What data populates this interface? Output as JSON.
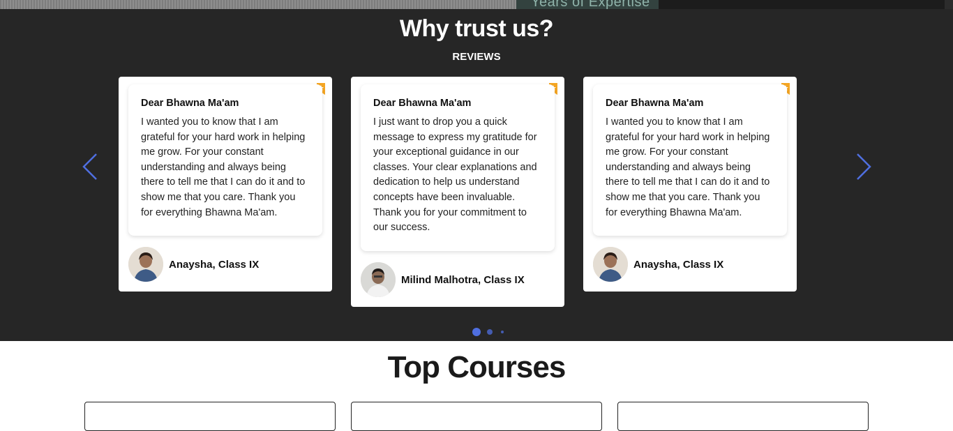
{
  "banner": {
    "expertise_text": "Years of Expertise"
  },
  "reviews_section": {
    "title": "Why trust us?",
    "subtitle": "REVIEWS",
    "prev_icon": "chevron-left-icon",
    "next_icon": "chevron-right-icon",
    "accent_color": "#4f6fe0",
    "bookmark_color": "#f5a623",
    "cards": [
      {
        "heading": "Dear Bhawna Ma'am",
        "body": "I wanted you to know that I am grateful for your hard work in helping me grow. For your constant understanding and always being there to tell me that I can do it and to show me that you care. Thank you for everything Bhawna Ma'am.",
        "author": "Anaysha, Class IX"
      },
      {
        "heading": "Dear Bhawna Ma'am",
        "body": "I just want to drop you a quick message to express my gratitude for your exceptional guidance in our classes. Your clear explanations and dedication to help us understand concepts have been invaluable. Thank you for your commitment to our success.",
        "author": "Milind Malhotra, Class IX"
      },
      {
        "heading": "Dear Bhawna Ma'am",
        "body": "I wanted you to know that I am grateful for your hard work in helping me grow. For your constant understanding and always being there to tell me that I can do it and to show me that you care. Thank you for everything Bhawna Ma'am.",
        "author": "Anaysha, Class IX"
      }
    ],
    "pagination": {
      "pages": 3,
      "active": 1
    }
  },
  "courses_section": {
    "title": "Top Courses"
  }
}
